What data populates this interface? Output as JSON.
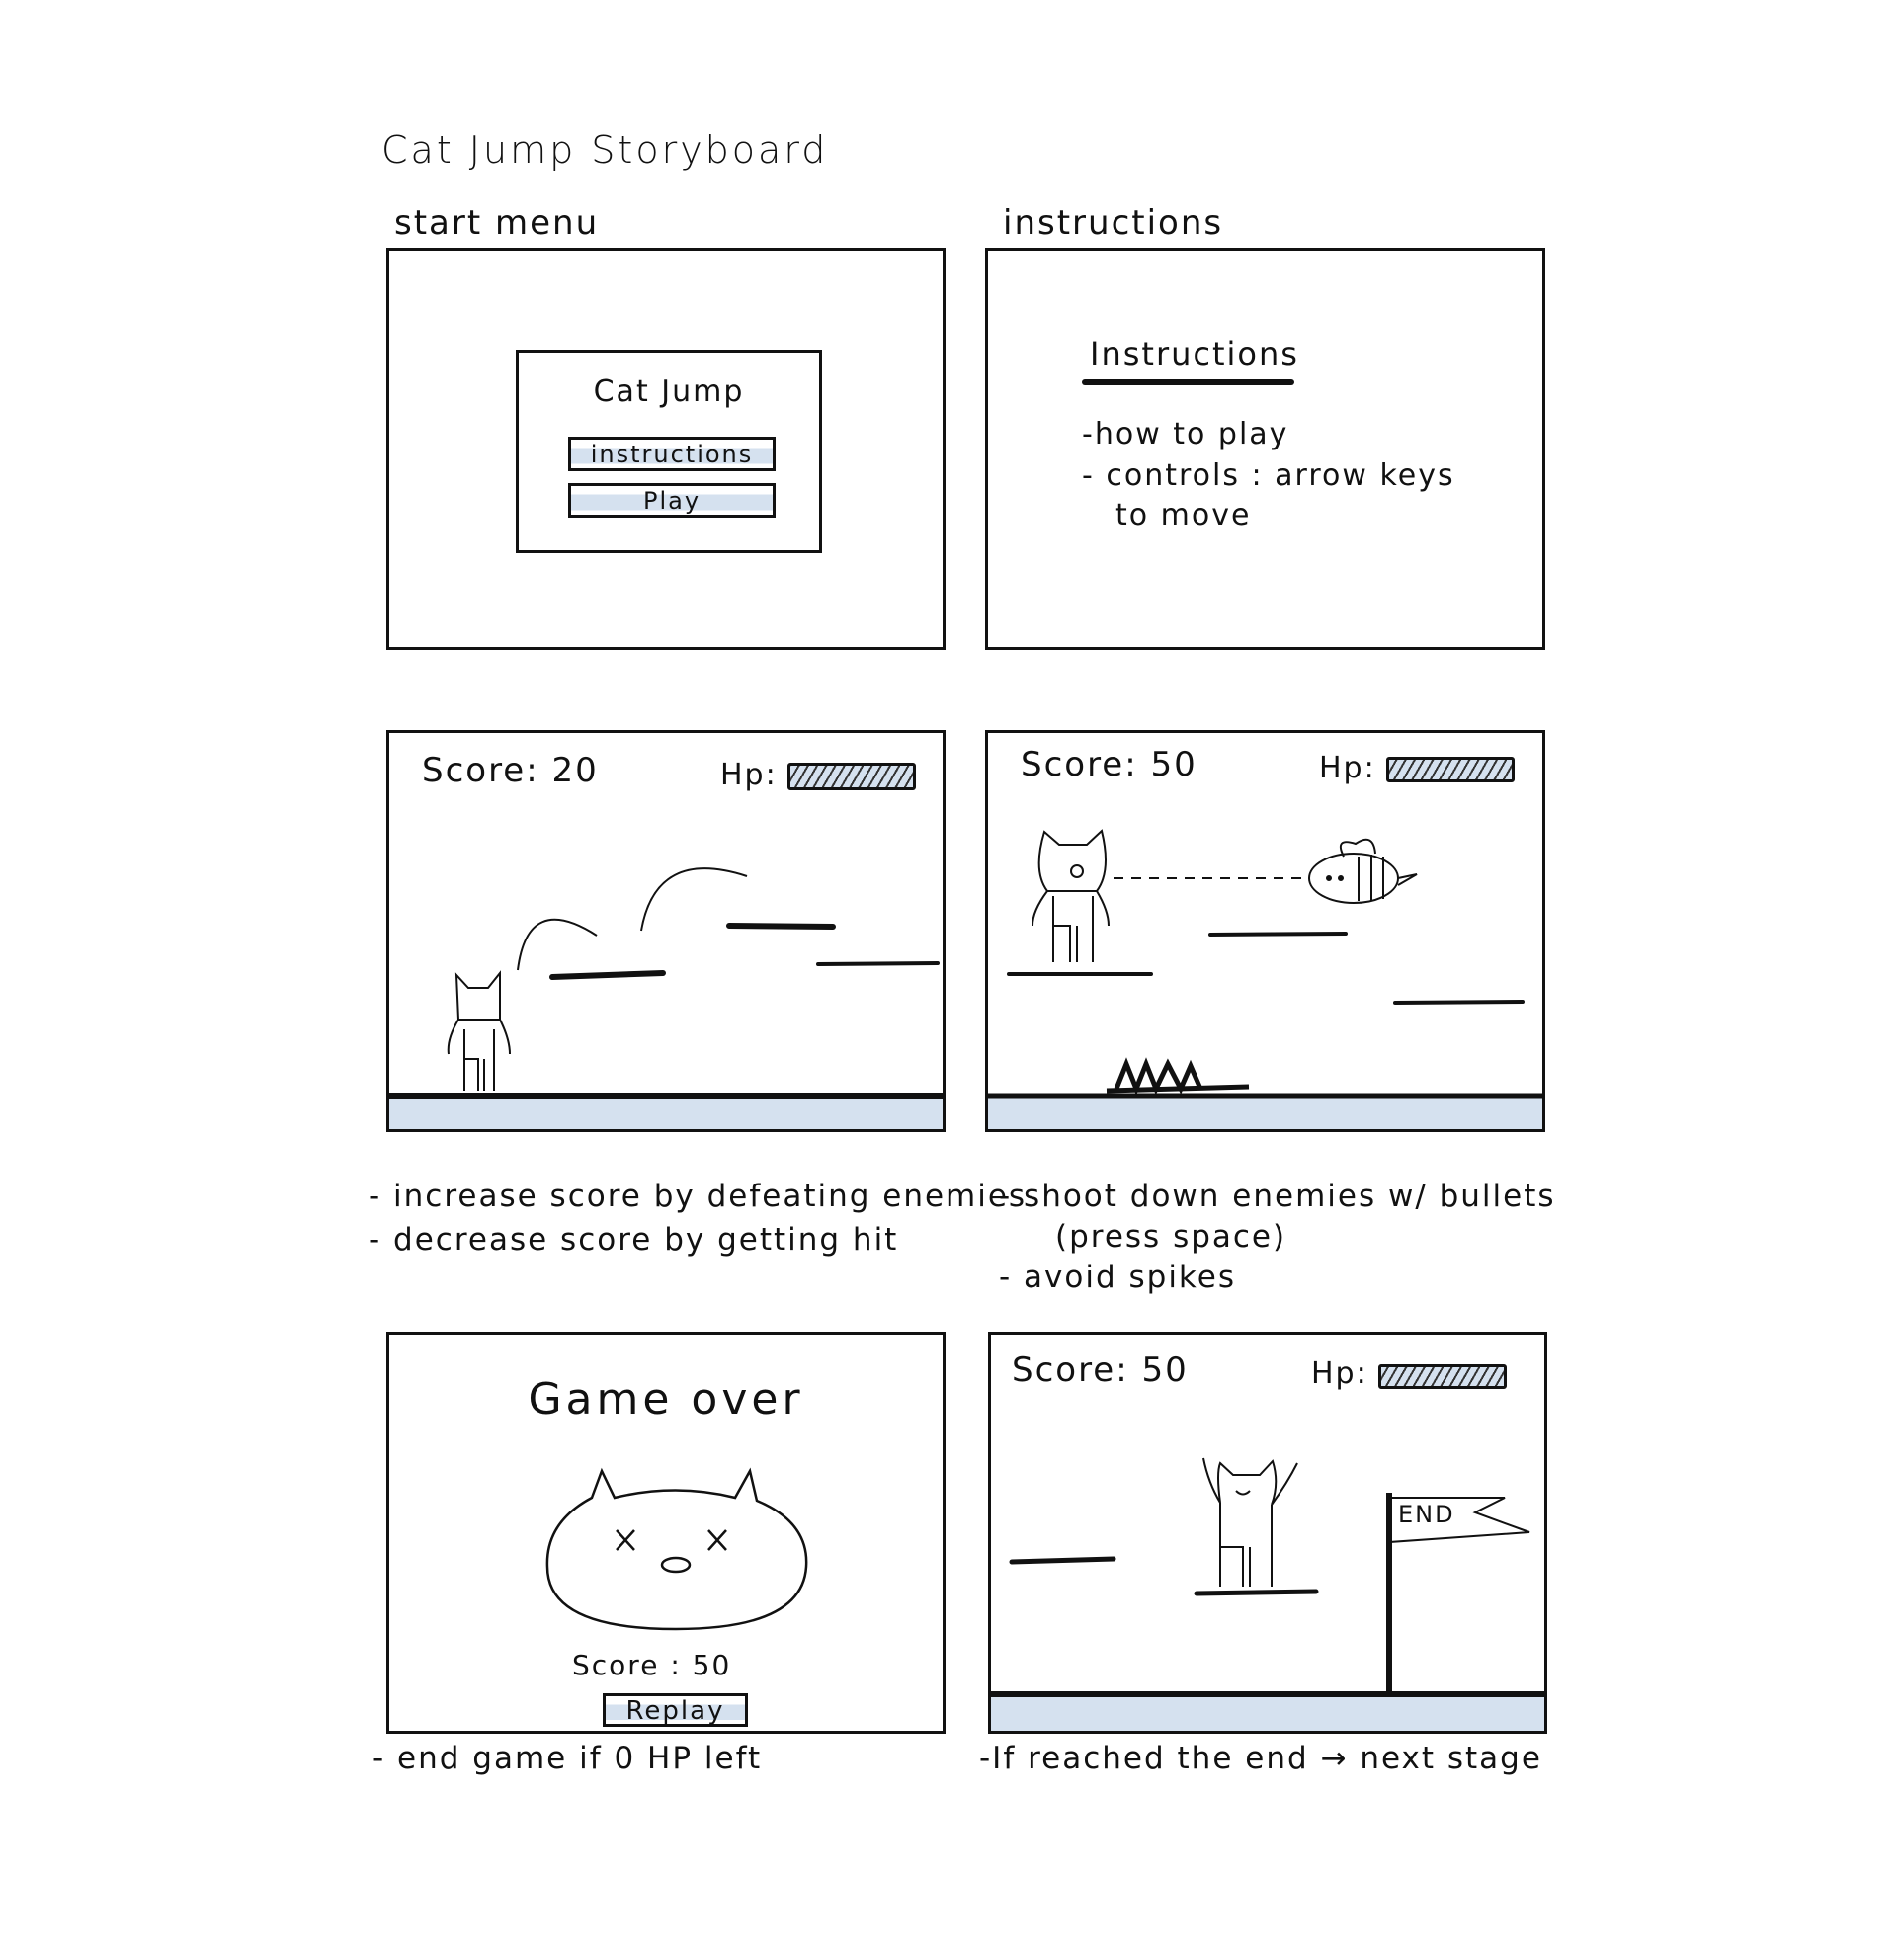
{
  "title": "Cat Jump Storyboard",
  "panels": {
    "start_menu": {
      "label": "start menu",
      "game_title": "Cat Jump",
      "instructions_button": "instructions",
      "play_button": "Play"
    },
    "instructions": {
      "label": "instructions",
      "heading": "Instructions",
      "lines": [
        "-how to play",
        "- controls : arrow keys",
        "to move"
      ]
    },
    "gameplay_1": {
      "score_text": "Score: 20",
      "hp_label": "Hp:",
      "hp_fraction": 0.9,
      "captions": [
        "- increase score by defeating enemies",
        "- decrease score by getting hit"
      ]
    },
    "gameplay_2": {
      "score_text": "Score: 50",
      "hp_label": "Hp:",
      "hp_fraction": 0.9,
      "captions": [
        "- shoot down enemies w/ bullets",
        "(press space)",
        "- avoid spikes"
      ]
    },
    "game_over": {
      "heading": "Game over",
      "score_text": "Score : 50",
      "replay_button": "Replay",
      "caption": "- end game if 0 HP left"
    },
    "next_stage": {
      "score_text": "Score: 50",
      "hp_label": "Hp:",
      "hp_fraction": 0.9,
      "flag_text": "END",
      "caption": "-If reached the end → next stage"
    }
  },
  "colors": {
    "ink": "#111111",
    "highlight": "#d5e1ef"
  }
}
